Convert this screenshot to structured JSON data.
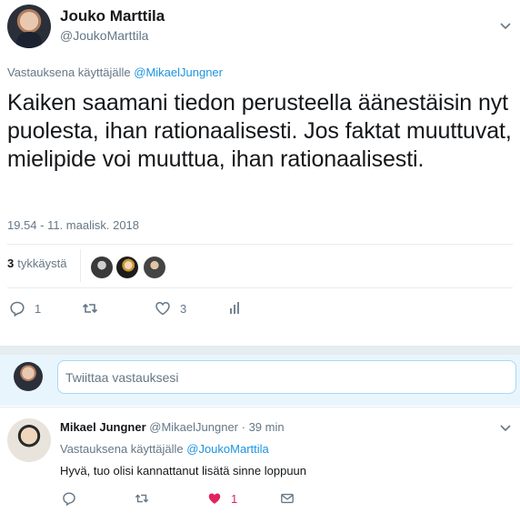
{
  "tweet": {
    "author_name": "Jouko Marttila",
    "author_handle": "@JoukoMarttila",
    "reply_prefix": "Vastauksena käyttäjälle",
    "reply_to_handle": "@MikaelJungner",
    "text": "Kaiken saamani tiedon perusteella äänestäisin nyt puolesta, ihan rationaalisesti. Jos faktat muuttuvat, mielipide voi muuttua, ihan rationaalisesti.",
    "timestamp": "19.54 - 11. maalisk. 2018",
    "likes_count": "3",
    "likes_label": "tykkäystä",
    "actions": {
      "reply_count": "1",
      "retweet_count": "",
      "like_count": "3"
    }
  },
  "composer": {
    "placeholder": "Twiittaa vastauksesi"
  },
  "reply": {
    "author_name": "Mikael Jungner",
    "author_handle": "@MikaelJungner",
    "time": "· 39 min",
    "reply_prefix": "Vastauksena käyttäjälle",
    "reply_to_handle": "@JoukoMarttila",
    "text": "Hyvä, tuo olisi kannattanut lisätä sinne loppuun",
    "like_count": "1"
  },
  "colors": {
    "link": "#1b95e0",
    "muted": "#657786",
    "like_active": "#e0245e",
    "divider": "#e6ecf0"
  }
}
